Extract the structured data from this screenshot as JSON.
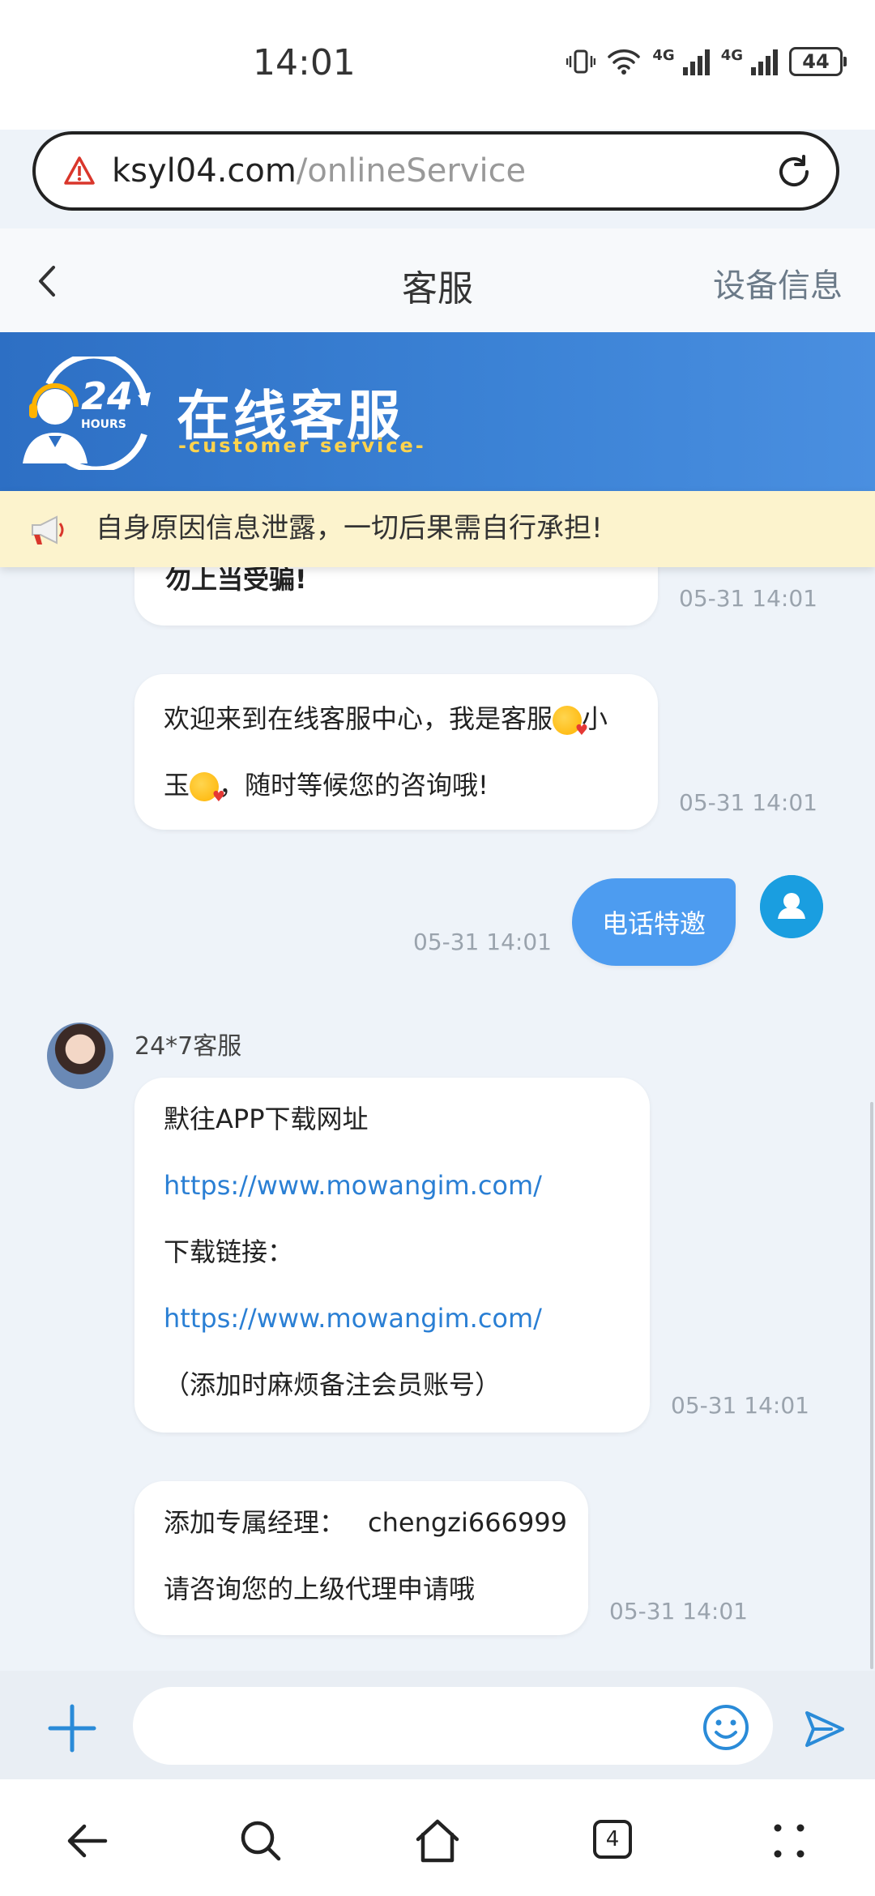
{
  "status_bar": {
    "time": "14:01",
    "network_1": "4G",
    "network_2": "4G",
    "battery": "44"
  },
  "browser": {
    "url_host": "ksyl04.com",
    "url_path": "/onlineService"
  },
  "header": {
    "title": "客服",
    "device_info": "设备信息"
  },
  "banner": {
    "logo_number": "24",
    "logo_label": "HOURS",
    "title": "在线客服",
    "subtitle": "-customer service-"
  },
  "notice": {
    "text": "自身原因信息泄露，一切后果需自行承担!"
  },
  "messages": {
    "m1": {
      "text": "勿上当受骗!",
      "time": "05-31 14:01"
    },
    "m2": {
      "line1_a": "欢迎来到在线客服中心，我是客服",
      "line1_b": "小",
      "line2_a": "玉",
      "line2_b": "，随时等候您的咨询哦!",
      "time": "05-31 14:01"
    },
    "m3": {
      "text": "电话特邀",
      "time": "05-31 14:01"
    },
    "m4": {
      "sender": "24*7客服",
      "line1": "默往APP下载网址",
      "link1": "https://www.mowangim.com/",
      "line3": "下载链接：",
      "link2": "https://www.mowangim.com/",
      "line5": "（添加时麻烦备注会员账号）",
      "time": "05-31 14:01"
    },
    "m5": {
      "label": "添加专属经理：",
      "account": "chengzi666999",
      "line2": "请咨询您的上级代理申请哦",
      "time": "05-31 14:01"
    }
  },
  "input": {
    "placeholder": ""
  },
  "nav": {
    "tabs_count": "4"
  },
  "colors": {
    "primary": "#4d9cf0",
    "banner": "#3c83d6",
    "notice_bg": "#fcf3cd",
    "link": "#2a7fd4"
  }
}
